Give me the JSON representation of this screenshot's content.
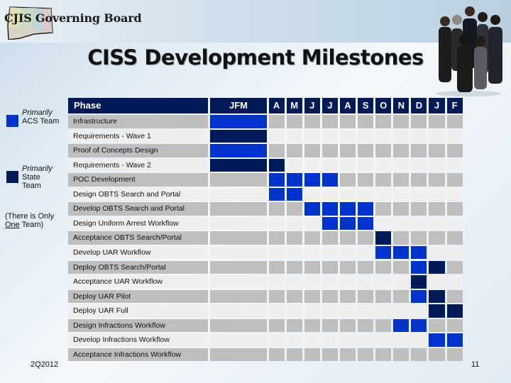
{
  "header": {
    "brand": "CJIS Governing Board",
    "title": "CISS Development Milestones"
  },
  "legend": [
    {
      "qualifier": "Primarily",
      "label": "ACS Team",
      "color": "#0033cc"
    },
    {
      "qualifier": "Primarily",
      "label_line1": "State",
      "label_line2": "Team",
      "color": "#001a57"
    }
  ],
  "note": {
    "line1": "(There is Only",
    "underlined": "One",
    "line2_rest": " Team)"
  },
  "table": {
    "phase_header": "Phase",
    "periods": [
      "JFM",
      "A",
      "M",
      "J",
      "J",
      "A",
      "S",
      "O",
      "N",
      "D",
      "J",
      "F"
    ],
    "colors": {
      "acs": "#0033cc",
      "state": "#001a57",
      "row_odd": "#bebebe",
      "row_even": "#efefef"
    },
    "rows": [
      {
        "phase": "Infrastructure",
        "cells": {
          "0": "acs"
        }
      },
      {
        "phase": "Requirements - Wave 1",
        "cells": {
          "0": "state"
        }
      },
      {
        "phase": "Proof of Concepts Design",
        "cells": {
          "0": "acs"
        }
      },
      {
        "phase": "Requirements - Wave 2",
        "cells": {
          "0": "state",
          "1": "state"
        }
      },
      {
        "phase": "POC Development",
        "cells": {
          "1": "acs",
          "2": "acs",
          "3": "acs",
          "4": "acs"
        }
      },
      {
        "phase": "Design OBTS Search and Portal",
        "cells": {
          "1": "acs",
          "2": "acs"
        }
      },
      {
        "phase": "Develop OBTS Search and Portal",
        "cells": {
          "3": "acs",
          "4": "acs",
          "5": "acs",
          "6": "acs"
        }
      },
      {
        "phase": "Design Uniform  Arrest Workflow",
        "cells": {
          "4": "acs",
          "5": "acs",
          "6": "acs"
        }
      },
      {
        "phase": "Acceptance  OBTS Search/Portal",
        "cells": {
          "7": "state"
        }
      },
      {
        "phase": "Develop UAR Workflow",
        "cells": {
          "7": "acs",
          "8": "acs",
          "9": "acs"
        }
      },
      {
        "phase": "Deploy OBTS Search/Portal",
        "cells": {
          "9": "acs",
          "10": "state"
        }
      },
      {
        "phase": "Acceptance UAR Workflow",
        "cells": {
          "9": "state"
        }
      },
      {
        "phase": "Deploy UAR Pilot",
        "cells": {
          "9": "acs",
          "10": "state"
        }
      },
      {
        "phase": "Deploy UAR Full",
        "cells": {
          "10": "state",
          "11": "state"
        }
      },
      {
        "phase": "Design Infractions Workflow",
        "cells": {
          "8": "acs",
          "9": "acs"
        }
      },
      {
        "phase": "Develop Infractions Workflow",
        "cells": {
          "10": "acs",
          "11": "acs"
        }
      },
      {
        "phase": "Acceptance Infractions Workflow",
        "cells": {}
      }
    ]
  },
  "footer": {
    "date": "2Q2012",
    "page": "11"
  }
}
